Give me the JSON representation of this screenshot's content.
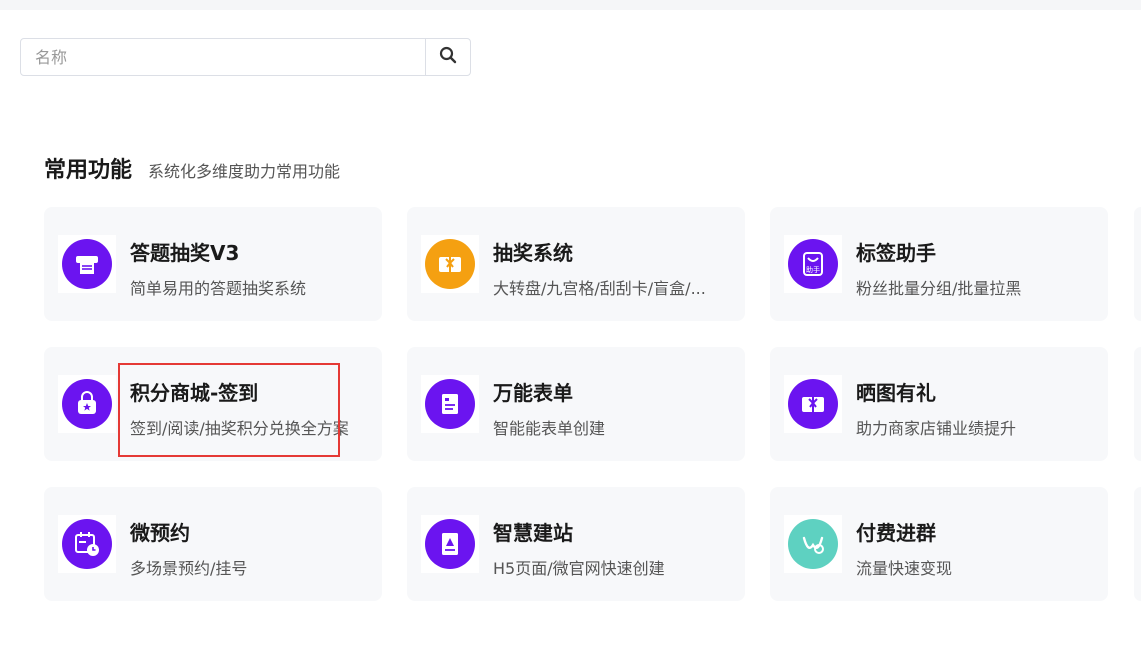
{
  "search": {
    "placeholder": "名称",
    "icon": "search-icon"
  },
  "section": {
    "title": "常用功能",
    "subtitle": "系统化多维度助力常用功能"
  },
  "colors": {
    "purple": "#6b14f0",
    "orange": "#f5a011",
    "teal": "#5ed1c1",
    "highlight": "#e53935"
  },
  "cards": [
    {
      "title": "答题抽奖V3",
      "desc": "简单易用的答题抽奖系统",
      "icon": "printer-icon"
    },
    {
      "title": "抽奖系统",
      "desc": "大转盘/九宫格/刮刮卡/盲盒/...",
      "icon": "gift-card-icon"
    },
    {
      "title": "标签助手",
      "desc": "粉丝批量分组/批量拉黑",
      "icon": "helper-bag-icon",
      "icon_text": "助手"
    },
    {
      "title": "积分商城-签到",
      "desc": "签到/阅读/抽奖积分兑换全方案",
      "icon": "shopping-bag-icon"
    },
    {
      "title": "万能表单",
      "desc": "智能能表单创建",
      "icon": "form-icon"
    },
    {
      "title": "晒图有礼",
      "desc": "助力商家店铺业绩提升",
      "icon": "gift-card-icon"
    },
    {
      "title": "微预约",
      "desc": "多场景预约/挂号",
      "icon": "calendar-clock-icon"
    },
    {
      "title": "智慧建站",
      "desc": "H5页面/微官网快速创建",
      "icon": "site-page-icon"
    },
    {
      "title": "付费进群",
      "desc": "流量快速变现",
      "icon": "group-logo-icon"
    }
  ]
}
